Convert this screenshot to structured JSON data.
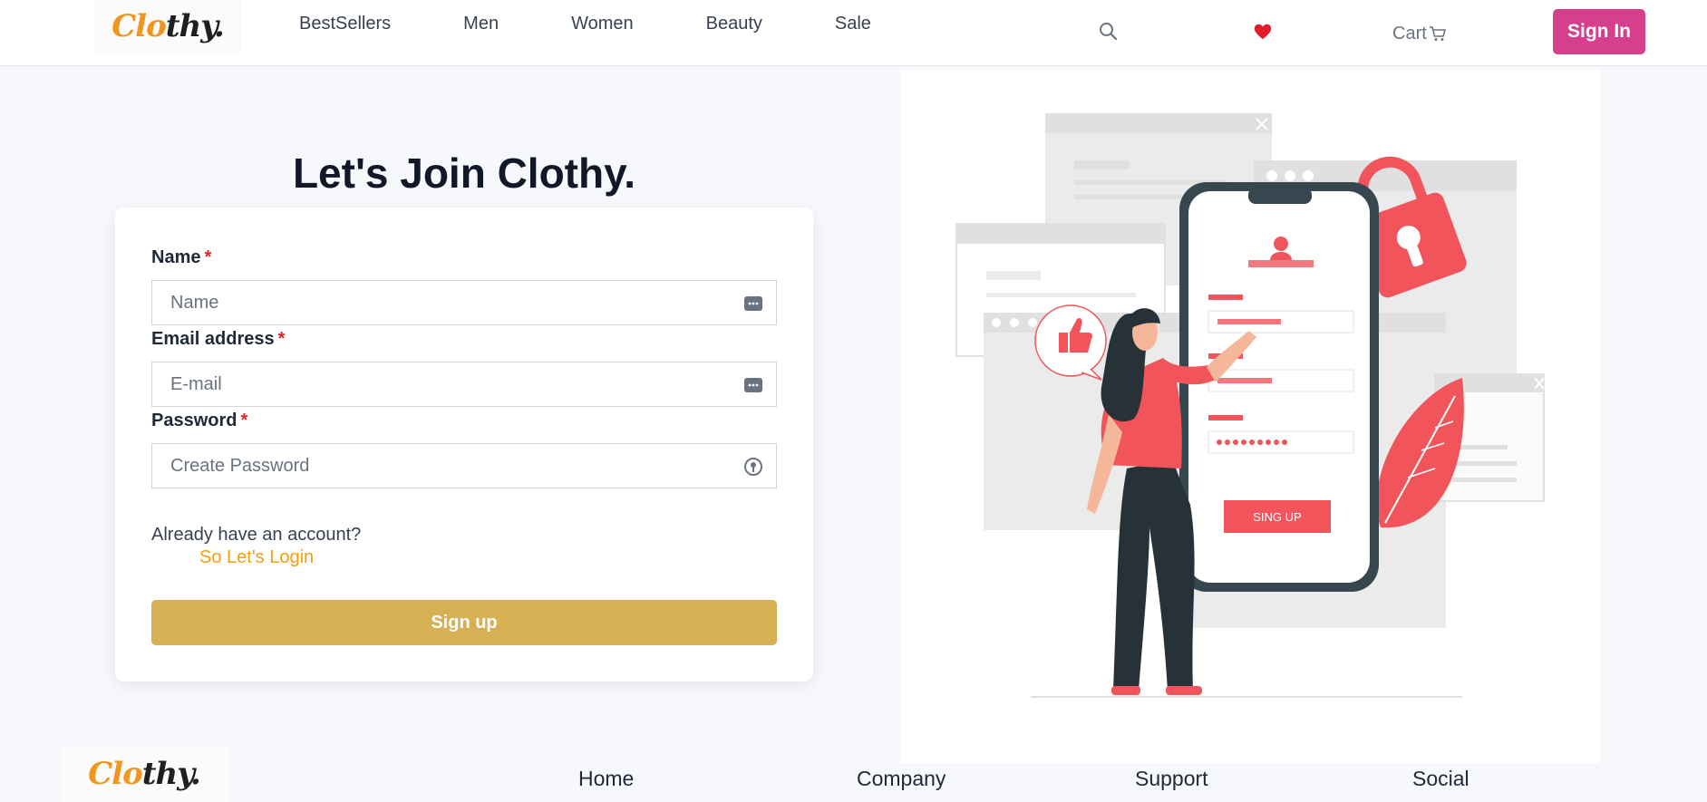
{
  "brand": {
    "logo_part1": "Clo",
    "logo_part2": "thy."
  },
  "nav": [
    "BestSellers",
    "Men",
    "Women",
    "Beauty",
    "Sale"
  ],
  "header": {
    "cart_label": "Cart",
    "signin_label": "Sign In",
    "heart_color": "#e11d2b"
  },
  "form": {
    "title": "Let's Join Clothy.",
    "fields": [
      {
        "label": "Name",
        "required": "*",
        "placeholder": "Name",
        "value": "",
        "icon": "autofill-icon"
      },
      {
        "label": "Email address",
        "required": "*",
        "placeholder": "E-mail",
        "value": "",
        "icon": "autofill-icon"
      },
      {
        "label": "Password",
        "required": "*",
        "placeholder": "Create Password",
        "value": "",
        "icon": "password-key-icon"
      }
    ],
    "already_text": "Already have an account?",
    "login_link": "So Let's Login",
    "submit_label": "Sign up"
  },
  "illustration": {
    "button_text": "SING UP",
    "accent": "#f2545b",
    "dark": "#263238"
  },
  "footer": {
    "links": [
      "Home",
      "Company",
      "Support",
      "Social"
    ]
  },
  "colors": {
    "primary_pink": "#d63f8c",
    "signup_gold": "#d6b052",
    "link_orange": "#f59e0b",
    "logo_orange": "#f0951d"
  }
}
